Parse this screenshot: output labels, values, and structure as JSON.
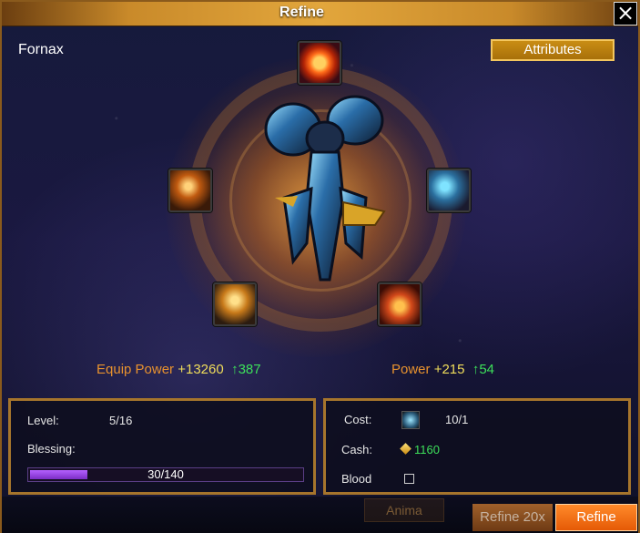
{
  "window": {
    "title": "Refine",
    "close_label": "×"
  },
  "item": {
    "name": "Fornax"
  },
  "header": {
    "attributes_label": "Attributes"
  },
  "skills": [
    "fire-orb-icon",
    "burst-icon",
    "frost-warrior-icon",
    "golden-knight-icon",
    "flame-icon"
  ],
  "stats": {
    "equip_power_label": "Equip Power",
    "equip_power_value": "+13260",
    "equip_power_gain": "↑387",
    "power_label": "Power",
    "power_value": "+215",
    "power_gain": "↑54"
  },
  "left_panel": {
    "level_label": "Level:",
    "level_value": "5/16",
    "blessing_label": "Blessing:",
    "blessing_text": "30/140",
    "blessing_current": 30,
    "blessing_max": 140
  },
  "right_panel": {
    "cost_label": "Cost:",
    "cost_value": "10/1",
    "cash_label": "Cash:",
    "cash_value": "1160",
    "blood_label": "Blood"
  },
  "buttons": {
    "anima_label": "Anima",
    "refine20_label": "Refine 20x",
    "refine_label": "Refine"
  },
  "colors": {
    "accent": "#e8922e",
    "value": "#f0dd5a",
    "gain": "#3de05a",
    "refine_button": "#ff7a1e"
  }
}
